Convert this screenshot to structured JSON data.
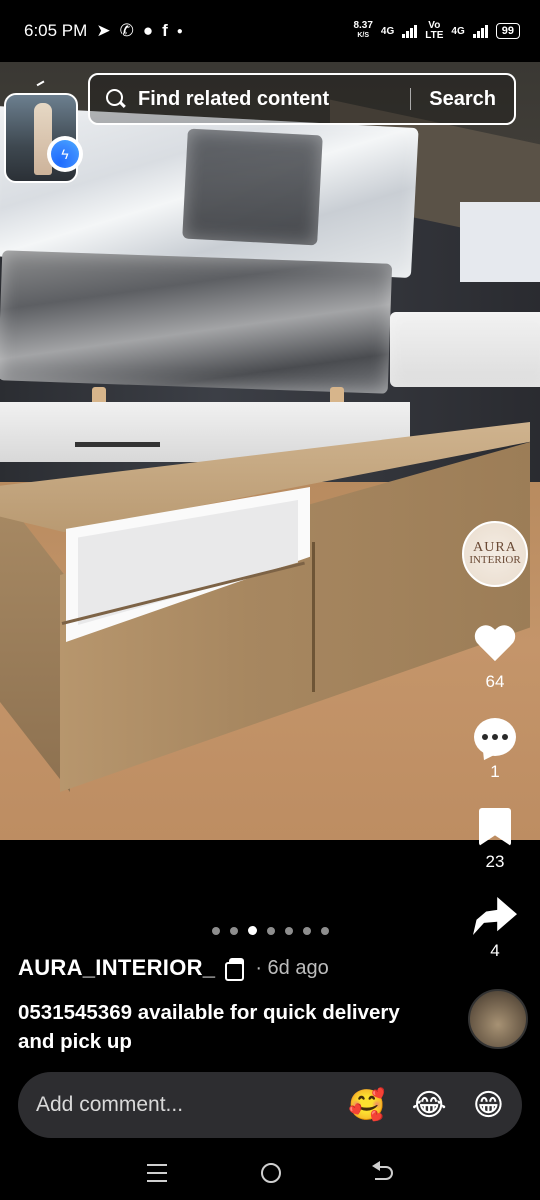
{
  "status_bar": {
    "time": "6:05 PM",
    "notification_icons": [
      "telegram-icon",
      "whatsapp-icon",
      "chat-icon",
      "facebook-icon",
      "dot-icon"
    ],
    "net_speed_value": "8.37",
    "net_speed_unit": "K/S",
    "net1_label": "4G",
    "volte_label_top": "Vo",
    "volte_label_bottom": "LTE",
    "net2_label": "4G",
    "battery": "99"
  },
  "search": {
    "placeholder": "Find related content",
    "button_label": "Search"
  },
  "brand_avatar": {
    "line1": "AURA",
    "line2": "INTERIOR"
  },
  "actions": {
    "likes": "64",
    "comments": "1",
    "saves": "23",
    "shares": "4"
  },
  "carousel": {
    "total": 7,
    "active_index": 2
  },
  "post": {
    "author": "AURA_INTERIOR_",
    "time_ago": "· 6d ago",
    "caption": "0531545369 available for quick delivery and pick up"
  },
  "comment_bar": {
    "placeholder": "Add comment...",
    "emojis": [
      "🥰",
      "😂",
      "😁"
    ]
  },
  "colors": {
    "background": "#000000",
    "comment_bar": "#2d2d30",
    "messenger_blue": "#1e6bff"
  }
}
